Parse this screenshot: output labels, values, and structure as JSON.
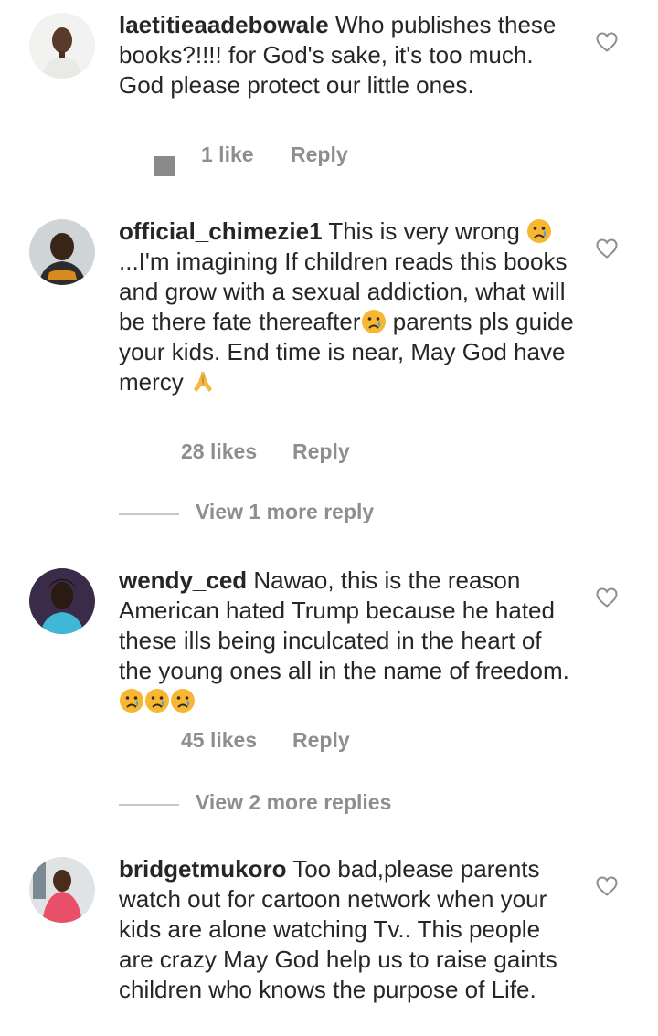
{
  "comments": [
    {
      "username": "laetitieaadebowale",
      "text": "Who publishes these books?!!!! for God's sake, it's too much. God please protect our little ones.",
      "likes": "1 like",
      "reply": "Reply"
    },
    {
      "username": "official_chimezie1",
      "text_parts": [
        "This is very wrong ",
        "...I'm imagining If children reads this books and grow with a sexual addiction, what will be there fate thereafter",
        " parents pls guide your kids. End time is near, May God have mercy "
      ],
      "likes": "28 likes",
      "reply": "Reply",
      "view_more": "View 1 more reply"
    },
    {
      "username": "wendy_ced",
      "text": "Nawao, this is the reason American hated Trump because he hated these ills being inculcated in the heart of the young ones all in the name of freedom.",
      "likes": "45 likes",
      "reply": "Reply",
      "view_more": "View 2 more replies"
    },
    {
      "username": "bridgetmukoro",
      "text": "Too bad,please parents watch out for cartoon network when your kids are alone watching Tv.. This people are crazy May God help us to raise gaints children who knows the purpose of Life."
    }
  ],
  "icons": {
    "like": "heart-outline-icon",
    "crying": "crying-face-emoji",
    "prayer": "folded-hands-emoji"
  },
  "colors": {
    "text": "#262626",
    "muted": "#8e8e8e",
    "divider": "#c7c7c7",
    "emoji_yellow": "#f7b733",
    "tear": "#4aa3df"
  }
}
